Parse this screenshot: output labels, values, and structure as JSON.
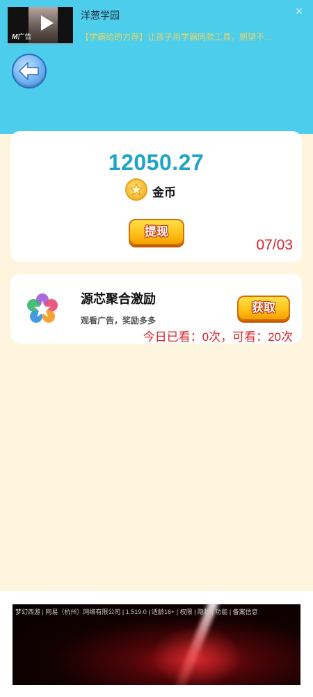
{
  "top_ad": {
    "title": "洋葱学园",
    "description": "【学霸给的力荐】让孩子用学霸同款工具，期望不…",
    "tag": "广告",
    "close_symbol": "×"
  },
  "coins": {
    "amount": "12050.27",
    "label": "金币",
    "withdraw_label": "提现",
    "date": "07/03"
  },
  "reward": {
    "title": "源芯聚合激励",
    "subtitle": "观看广告，奖励多多",
    "button_label": "获取",
    "watch_count": "今日已看：0次，可看：20次"
  },
  "bottom_ad": {
    "text": "梦幻西游 | 网易（杭州）网络有限公司 | 1.519.0 | 适龄16+ | 权限 | 隐私 | 功能 | 备案信息"
  },
  "colors": {
    "header": "#4ccdec",
    "background": "#fdf5de",
    "amount": "#1ea4c8",
    "red_text": "#d7232a",
    "button_yellow": "#ffc21a"
  }
}
